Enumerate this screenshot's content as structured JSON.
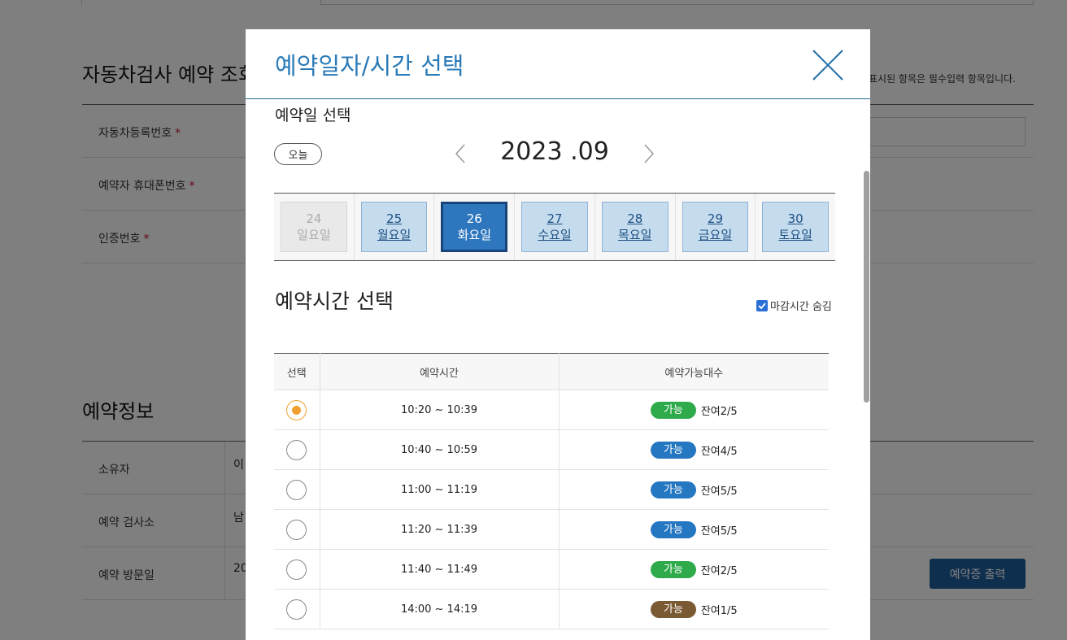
{
  "background": {
    "lookup_title": "자동차검사 예약 조회",
    "required_note": "표시된 항목은 필수입력 항목입니다.",
    "form_rows": [
      {
        "label": "자동차등록번호",
        "required": "*"
      },
      {
        "label": "예약자 휴대폰번호",
        "required": "*"
      },
      {
        "label": "인증번호",
        "required": "*"
      }
    ],
    "info_title": "예약정보",
    "info_rows": [
      {
        "label": "소유자",
        "value": "이"
      },
      {
        "label": "예약 검사소",
        "value": "남"
      },
      {
        "label": "예약 방문일",
        "value": "20"
      }
    ],
    "print_button": "예약증 출력"
  },
  "modal": {
    "title": "예약일자/시간 선택",
    "date_section_label": "예약일 선택",
    "today_label": "오늘",
    "month_label": "2023 .09",
    "dates": [
      {
        "day": "24",
        "weekday": "일요일",
        "state": "disabled"
      },
      {
        "day": "25",
        "weekday": "월요일",
        "state": "normal"
      },
      {
        "day": "26",
        "weekday": "화요일",
        "state": "selected"
      },
      {
        "day": "27",
        "weekday": "수요일",
        "state": "normal"
      },
      {
        "day": "28",
        "weekday": "목요일",
        "state": "normal"
      },
      {
        "day": "29",
        "weekday": "금요일",
        "state": "normal"
      },
      {
        "day": "30",
        "weekday": "토요일",
        "state": "normal"
      }
    ],
    "time_section_title": "예약시간 선택",
    "hide_closed_label": "마감시간 숨김",
    "hide_closed_checked": true,
    "table_headers": [
      "선택",
      "예약시간",
      "예약가능대수"
    ],
    "slots": [
      {
        "selected": true,
        "time": "10:20 ~ 10:39",
        "status": "가능",
        "status_color": "#2eaa4a",
        "remaining": "잔여2/5"
      },
      {
        "selected": false,
        "time": "10:40 ~ 10:59",
        "status": "가능",
        "status_color": "#2577c2",
        "remaining": "잔여4/5"
      },
      {
        "selected": false,
        "time": "11:00 ~ 11:19",
        "status": "가능",
        "status_color": "#2577c2",
        "remaining": "잔여5/5"
      },
      {
        "selected": false,
        "time": "11:20 ~ 11:39",
        "status": "가능",
        "status_color": "#2577c2",
        "remaining": "잔여5/5"
      },
      {
        "selected": false,
        "time": "11:40 ~ 11:49",
        "status": "가능",
        "status_color": "#2eaa4a",
        "remaining": "잔여2/5"
      },
      {
        "selected": false,
        "time": "14:00 ~ 14:19",
        "status": "가능",
        "status_color": "#7a5a33",
        "remaining": "잔여1/5"
      }
    ]
  },
  "icons": {
    "close": "close-icon",
    "prev": "chevron-left-icon",
    "next": "chevron-right-icon",
    "check": "check-icon"
  },
  "colors": {
    "title": "#2a7ab8",
    "selected_date": "#2e77be",
    "date_normal": "#c5dcef",
    "radio_checked": "#f0a030",
    "print_button": "#1f5f9e"
  }
}
